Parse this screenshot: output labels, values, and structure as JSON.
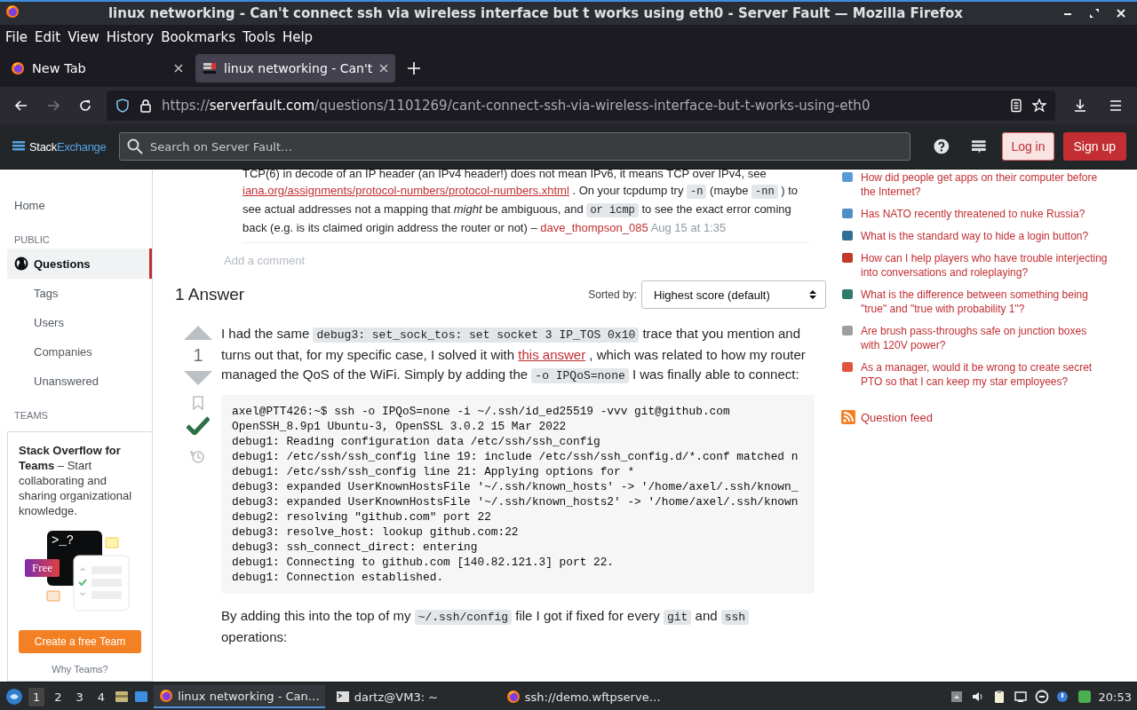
{
  "window": {
    "title": "linux networking - Can't connect ssh via wireless interface but t works using eth0 - Server Fault — Mozilla Firefox"
  },
  "menu": [
    "File",
    "Edit",
    "View",
    "History",
    "Bookmarks",
    "Tools",
    "Help"
  ],
  "tabs": [
    {
      "label": "New Tab",
      "kind": "firefox",
      "selected": false
    },
    {
      "label": "linux networking - Can't",
      "kind": "site",
      "selected": true
    }
  ],
  "nav": {
    "forward_disabled": true,
    "url": {
      "scheme": "https://",
      "host": "serverfault.com",
      "path": "/questions/1101269/cant-connect-ssh-via-wireless-interface-but-t-works-using-eth0"
    }
  },
  "header": {
    "logo_a": "Stack",
    "logo_b": "Exchange",
    "search_placeholder": "Search on Server Fault…",
    "login": "Log in",
    "signup": "Sign up"
  },
  "sidebar": {
    "items": [
      {
        "kind": "link",
        "label": "Home",
        "selected": false
      },
      {
        "kind": "heading",
        "label": "PUBLIC"
      },
      {
        "kind": "link",
        "label": "Questions",
        "selected": true,
        "icon": true
      },
      {
        "kind": "sub",
        "label": "Tags",
        "selected": false
      },
      {
        "kind": "sub",
        "label": "Users",
        "selected": false
      },
      {
        "kind": "sub",
        "label": "Companies",
        "selected": false
      },
      {
        "kind": "sub",
        "label": "Unanswered",
        "selected": false
      },
      {
        "kind": "heading",
        "label": "TEAMS"
      }
    ],
    "teams": {
      "title": "Stack Overflow for Teams",
      "text": "– Start collaborating and sharing organizational knowledge.",
      "prompt": ">_?",
      "badge": "Free",
      "button": "Create a free Team",
      "link": "Why Teams?"
    }
  },
  "comment": {
    "segments": [
      {
        "kind": "text",
        "text": "TCP(6) in decode of an IP header (an IPv4 header!) does not mean IPv6, it means TCP over IPv4, see"
      },
      {
        "kind": "link",
        "text": "iana.org/assignments/protocol-numbers/protocol-numbers.xhtml"
      },
      {
        "kind": "text",
        "text": ". On your tcpdump try"
      },
      {
        "kind": "code",
        "text": "-n"
      },
      {
        "kind": "text",
        "text": "(maybe"
      },
      {
        "kind": "code",
        "text": "-nn"
      },
      {
        "kind": "text",
        "text": ") to see actual addresses not a mapping that *might* be ambiguous, and"
      },
      {
        "kind": "code",
        "text": "or icmp"
      },
      {
        "kind": "text",
        "text": "to see the exact error coming back (e.g. is its claimed origin address the router or not) –"
      },
      {
        "kind": "user",
        "text": "dave_thompson_085"
      },
      {
        "kind": "date",
        "text": "Aug 15 at 1:35"
      }
    ],
    "add": "Add a comment"
  },
  "answers": {
    "title": "1 Answer",
    "sort_label": "Sorted by:",
    "sort_value": "Highest score (default)"
  },
  "answer": {
    "score": "1",
    "accepted": true,
    "para1": [
      {
        "kind": "text",
        "text": "I had the same"
      },
      {
        "kind": "code",
        "text": "debug3: set_sock_tos: set socket 3 IP_TOS 0x10"
      },
      {
        "kind": "text",
        "text": "trace that you mention and turns out that, for my specific case, I solved it with"
      },
      {
        "kind": "link",
        "text": "this answer"
      },
      {
        "kind": "text",
        "text": ", which was related to how my router managed the QoS of the WiFi. Simply by adding the"
      },
      {
        "kind": "code",
        "text": "-o IPQoS=none"
      },
      {
        "kind": "text",
        "text": "I was finally able to connect:"
      }
    ],
    "code": [
      "axel@PTT426:~$ ssh -o IPQoS=none -i ~/.ssh/id_ed25519 -vvv git@github.com",
      "OpenSSH_8.9p1 Ubuntu-3, OpenSSL 3.0.2 15 Mar 2022",
      "debug1: Reading configuration data /etc/ssh/ssh_config",
      "debug1: /etc/ssh/ssh_config line 19: include /etc/ssh/ssh_config.d/*.conf matched n",
      "debug1: /etc/ssh/ssh_config line 21: Applying options for *",
      "debug3: expanded UserKnownHostsFile '~/.ssh/known_hosts' -> '/home/axel/.ssh/known_",
      "debug3: expanded UserKnownHostsFile '~/.ssh/known_hosts2' -> '/home/axel/.ssh/known",
      "debug2: resolving \"github.com\" port 22",
      "debug3: resolve_host: lookup github.com:22",
      "debug3: ssh_connect_direct: entering",
      "debug1: Connecting to github.com [140.82.121.3] port 22.",
      "debug1: Connection established."
    ],
    "para2": [
      {
        "kind": "text",
        "text": "By adding this into the top of my"
      },
      {
        "kind": "code",
        "text": "~/.ssh/config"
      },
      {
        "kind": "text",
        "text": "file I got if fixed for every"
      },
      {
        "kind": "code",
        "text": "git"
      },
      {
        "kind": "text",
        "text": "and"
      },
      {
        "kind": "code",
        "text": "ssh"
      },
      {
        "kind": "text",
        "text": "operations:"
      }
    ]
  },
  "hot": [
    {
      "text": "How did people get apps on their computer before the Internet?",
      "color": "#5b9bd5"
    },
    {
      "text": "Has NATO recently threatened to nuke Russia?",
      "color": "#4f8fc6"
    },
    {
      "text": "What is the standard way to hide a login button?",
      "color": "#2f6f96"
    },
    {
      "text": "How can I help players who have trouble interjecting into conversations and roleplaying?",
      "color": "#c0392b"
    },
    {
      "text": "What is the difference between something being \"true\" and \"true with probability 1\"?",
      "color": "#2e7d6b"
    },
    {
      "text": "Are brush pass-throughs safe on junction boxes with 120V power?",
      "color": "#9e9e9e"
    },
    {
      "text": "As a manager, would it be wrong to create secret PTO so that I can keep my star employees?",
      "color": "#e0533d"
    }
  ],
  "feed": "Question feed",
  "taskbar": {
    "workspaces": [
      {
        "label": "1",
        "selected": true
      },
      {
        "label": "2",
        "selected": false
      },
      {
        "label": "3",
        "selected": false
      },
      {
        "label": "4",
        "selected": false
      }
    ],
    "tasks": [
      {
        "kind": "firefox",
        "label": "linux networking - Can…",
        "selected": true
      },
      {
        "kind": "terminal",
        "label": "dartz@VM3: ~",
        "selected": false
      },
      {
        "kind": "firefox",
        "label": "ssh://demo.wftpserve…",
        "selected": false
      }
    ],
    "clock": "20:53"
  }
}
